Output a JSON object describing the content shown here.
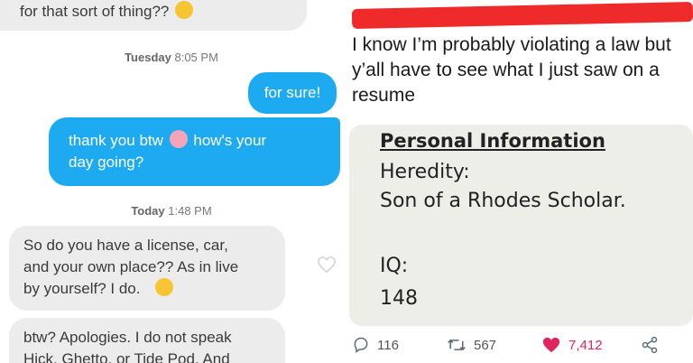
{
  "chat": {
    "msg_top": "for that sort of thing??",
    "stamp1_day": "Tuesday",
    "stamp1_time": "8:05 PM",
    "msg_sure": "for sure!",
    "msg_thanks_a": "thank you btw",
    "msg_thanks_b": "how's your",
    "msg_thanks_c": "day going?",
    "stamp2_day": "Today",
    "stamp2_time": "1:48 PM",
    "msg_q1": "So do you have a license, car,",
    "msg_q2": "and your own place?? As in live",
    "msg_q3": "by yourself? I do.",
    "msg_b1": "btw? Apologies. I do not speak",
    "msg_b2": "Hick, Ghetto, or Tide Pod. And"
  },
  "tweet": {
    "text_line1": "I know I’m probably violating a law but",
    "text_line2": "y’all have to see what I just saw on a",
    "text_line3": "resume"
  },
  "photo": {
    "heading": "Personal Information",
    "line1": "Heredity:",
    "line2": "Son of a Rhodes Scholar.",
    "line3": "IQ:",
    "line4": "148"
  },
  "actions": {
    "replies": "116",
    "retweets": "567",
    "likes": "7,412"
  },
  "colors": {
    "outgoing_bubble": "#1eaaf1",
    "incoming_bubble": "#ececec",
    "redaction": "#ee2a2a",
    "like": "#e0245e"
  }
}
